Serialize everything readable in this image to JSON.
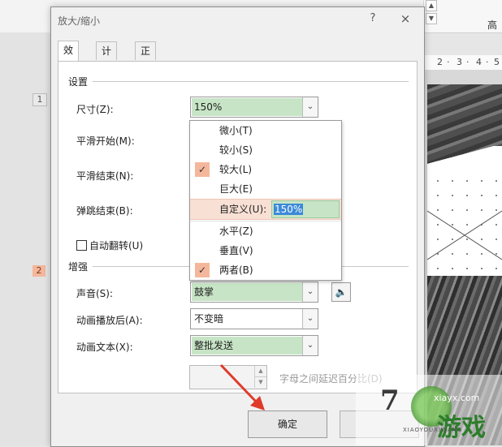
{
  "background": {
    "ruler_ticks": [
      "2",
      "·",
      "3",
      "·",
      "4",
      "·",
      "5"
    ],
    "slide_numbers": [
      "1",
      "2"
    ],
    "ribbon_right_label": "高"
  },
  "dialog": {
    "title": "放大/缩小",
    "help_glyph": "?",
    "close_glyph": "×",
    "tabs": [
      {
        "label": "效果",
        "active": true
      },
      {
        "label": "计时",
        "active": false
      },
      {
        "label": "正文文本动画",
        "active": false
      }
    ],
    "settings_group": "设置",
    "enhance_group": "增强",
    "fields": {
      "size_label": "尺寸(Z):",
      "size_value": "150%",
      "smooth_start_label": "平滑开始(M):",
      "smooth_end_label": "平滑结束(N):",
      "bounce_end_label": "弹跳结束(B):",
      "autoreverse_label": "自动翻转(U)",
      "sound_label": "声音(S):",
      "sound_value": "鼓掌",
      "after_anim_label": "动画播放后(A):",
      "after_anim_value": "不变暗",
      "anim_text_label": "动画文本(X):",
      "anim_text_value": "整批发送",
      "delay_label": "字母之间延迟百分比(D)"
    },
    "ok_label": "确定",
    "dropdown": {
      "items": [
        {
          "label": "微小(T)",
          "checked": false
        },
        {
          "label": "较小(S)",
          "checked": false
        },
        {
          "label": "较大(L)",
          "checked": true
        },
        {
          "label": "巨大(E)",
          "checked": false
        },
        {
          "label": "自定义(U):",
          "checked": false
        },
        {
          "label": "水平(Z)",
          "checked": false
        },
        {
          "label": "垂直(V)",
          "checked": false
        },
        {
          "label": "两者(B)",
          "checked": true
        }
      ],
      "custom_value": "150%"
    }
  },
  "watermark": {
    "url": "xiayx.com",
    "text": "游戏",
    "sub": "XIAOYOUXIWANG"
  },
  "colors": {
    "combo_fill": "#c7e5c6",
    "check_fill": "#f4b79c",
    "highlight_row": "#f8e0d4",
    "selection": "#3b8ad8",
    "arrow": "#e03a2a"
  }
}
